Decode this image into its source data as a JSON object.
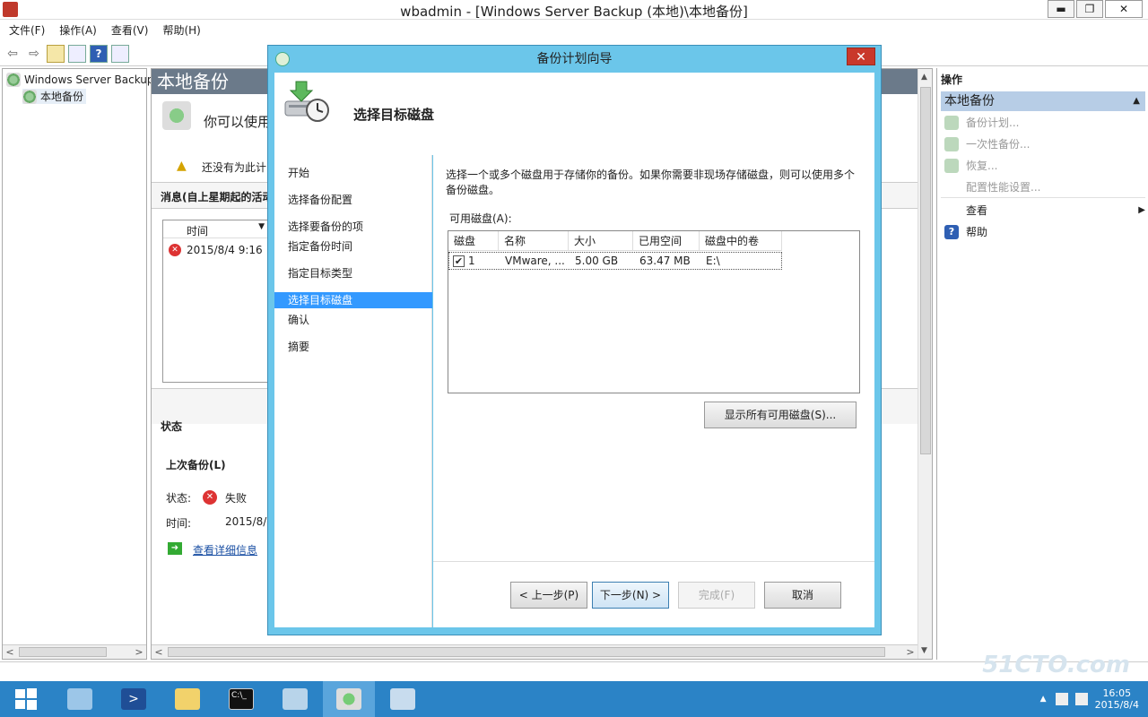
{
  "window": {
    "title": "wbadmin - [Windows Server Backup (本地)\\本地备份]",
    "minimize": "▬",
    "restore": "❐",
    "close": "✕"
  },
  "menu": [
    "文件(F)",
    "操作(A)",
    "查看(V)",
    "帮助(H)"
  ],
  "tree": {
    "root": "Windows Server Backup",
    "child": "本地备份"
  },
  "center": {
    "header": "本地备份",
    "intro": "你可以使用",
    "warning": "还没有为此计",
    "messages_label": "消息(自上星期起的活动",
    "col_time": "时间",
    "msg_time": "2015/8/4 9:16",
    "status_label": "状态",
    "last_backup": "上次备份(L)",
    "status_key": "状态:",
    "status_val": "失败",
    "time_key": "时间:",
    "time_val": "2015/8/",
    "details_link": "查看详细信息"
  },
  "actions": {
    "header": "操作",
    "section": "本地备份",
    "items": [
      {
        "label": "备份计划...",
        "disabled": true
      },
      {
        "label": "一次性备份...",
        "disabled": true
      },
      {
        "label": "恢复...",
        "disabled": true
      },
      {
        "label": "配置性能设置...",
        "disabled": true
      },
      {
        "label": "查看",
        "disabled": false
      },
      {
        "label": "帮助",
        "disabled": false
      }
    ]
  },
  "dialog": {
    "title": "备份计划向导",
    "close": "✕",
    "heading": "选择目标磁盘",
    "nav": [
      "开始",
      "选择备份配置",
      "选择要备份的项",
      "指定备份时间",
      "指定目标类型",
      "选择目标磁盘",
      "确认",
      "摘要"
    ],
    "active_nav_index": 5,
    "description": "选择一个或多个磁盘用于存储你的备份。如果你需要非现场存储磁盘，则可以使用多个备份磁盘。",
    "available_label": "可用磁盘(A):",
    "columns": [
      "磁盘",
      "名称",
      "大小",
      "已用空间",
      "磁盘中的卷"
    ],
    "rows": [
      {
        "checked": true,
        "disk": "1",
        "name": "VMware, ...",
        "size": "5.00 GB",
        "used": "63.47 MB",
        "volumes": "E:\\"
      }
    ],
    "show_all_button": "显示所有可用磁盘(S)...",
    "back_button": "< 上一步(P)",
    "next_button": "下一步(N) >",
    "finish_button": "完成(F)",
    "cancel_button": "取消"
  },
  "taskbar": {
    "tray_time": "16:05",
    "tray_date": "2015/8/4"
  },
  "watermark": "51CTO.com"
}
